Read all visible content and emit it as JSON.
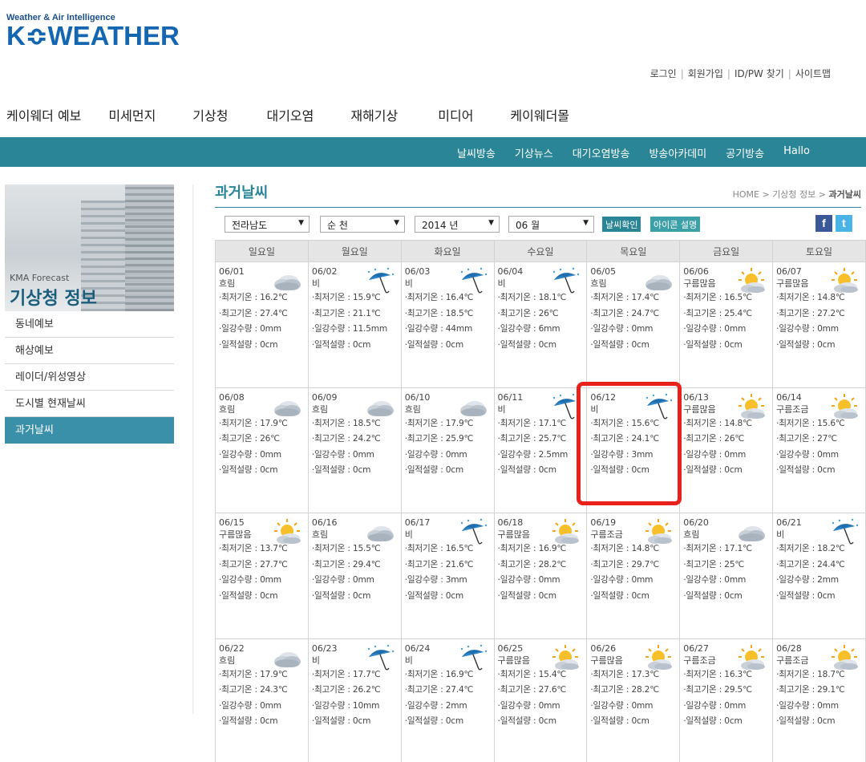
{
  "logo": {
    "tagline": "Weather & Air Intelligence",
    "brand": "K≎WEATHER"
  },
  "util_links": [
    "로그인",
    "회원가입",
    "ID/PW 찾기",
    "사이트맵"
  ],
  "gnb": [
    "케이웨더 예보",
    "미세먼지",
    "기상청",
    "대기오염",
    "재해기상",
    "미디어",
    "케이웨더몰"
  ],
  "subnav": [
    "날씨방송",
    "기상뉴스",
    "대기오염방송",
    "방송아카데미",
    "공기방송",
    "Hallo"
  ],
  "side": {
    "banner_en": "KMA Forecast",
    "banner_ko": "기상청 정보",
    "menu": [
      "동네예보",
      "해상예보",
      "레이더/위성영상",
      "도시별 현재날씨",
      "과거날씨"
    ],
    "active_index": 4
  },
  "main": {
    "title": "과거날씨",
    "breadcrumb": [
      "HOME",
      "기상청 정보",
      "과거날씨"
    ],
    "filters": {
      "region": "전라남도",
      "city": "순 천",
      "year": "2014 년",
      "month": "06 월"
    },
    "btn_check": "날씨확인",
    "btn_icon": "아이콘 설명",
    "sns": [
      "f",
      "t"
    ],
    "weekdays": [
      "일요일",
      "월요일",
      "화요일",
      "수요일",
      "목요일",
      "금요일",
      "토요일"
    ],
    "labels": {
      "min": "·최저기온 : ",
      "max": "·최고기온 : ",
      "rain": "·일강수량 : ",
      "snow": "·일적설량 : "
    },
    "days": [
      {
        "date": "06/01",
        "cond": "흐림",
        "icon": "cloud-icon",
        "min": "16.2℃",
        "max": "27.4℃",
        "rain": "0mm",
        "snow": "0cm"
      },
      {
        "date": "06/02",
        "cond": "비",
        "icon": "umbrella-icon",
        "min": "15.9℃",
        "max": "21.1℃",
        "rain": "11.5mm",
        "snow": "0cm"
      },
      {
        "date": "06/03",
        "cond": "비",
        "icon": "umbrella-icon",
        "min": "16.4℃",
        "max": "18.5℃",
        "rain": "44mm",
        "snow": "0cm"
      },
      {
        "date": "06/04",
        "cond": "비",
        "icon": "umbrella-icon",
        "min": "18.1℃",
        "max": "26℃",
        "rain": "6mm",
        "snow": "0cm"
      },
      {
        "date": "06/05",
        "cond": "흐림",
        "icon": "cloud-icon",
        "min": "17.4℃",
        "max": "24.7℃",
        "rain": "0mm",
        "snow": "0cm"
      },
      {
        "date": "06/06",
        "cond": "구름많음",
        "icon": "sun-cloud-icon",
        "min": "16.5℃",
        "max": "25.4℃",
        "rain": "0mm",
        "snow": "0cm"
      },
      {
        "date": "06/07",
        "cond": "구름많음",
        "icon": "sun-cloud-icon",
        "min": "14.8℃",
        "max": "27.2℃",
        "rain": "0mm",
        "snow": "0cm"
      },
      {
        "date": "06/08",
        "cond": "흐림",
        "icon": "cloud-icon",
        "min": "17.9℃",
        "max": "26℃",
        "rain": "0mm",
        "snow": "0cm"
      },
      {
        "date": "06/09",
        "cond": "흐림",
        "icon": "cloud-icon",
        "min": "18.5℃",
        "max": "24.2℃",
        "rain": "0mm",
        "snow": "0cm"
      },
      {
        "date": "06/10",
        "cond": "흐림",
        "icon": "cloud-icon",
        "min": "17.9℃",
        "max": "25.9℃",
        "rain": "0mm",
        "snow": "0cm"
      },
      {
        "date": "06/11",
        "cond": "비",
        "icon": "umbrella-icon",
        "min": "17.1℃",
        "max": "25.7℃",
        "rain": "2.5mm",
        "snow": "0cm"
      },
      {
        "date": "06/12",
        "cond": "비",
        "icon": "umbrella-icon",
        "min": "15.6℃",
        "max": "24.1℃",
        "rain": "3mm",
        "snow": "0cm"
      },
      {
        "date": "06/13",
        "cond": "구름많음",
        "icon": "sun-cloud-icon",
        "min": "14.8℃",
        "max": "26℃",
        "rain": "0mm",
        "snow": "0cm"
      },
      {
        "date": "06/14",
        "cond": "구름조금",
        "icon": "sun-cloud-icon",
        "min": "15.6℃",
        "max": "27℃",
        "rain": "0mm",
        "snow": "0cm"
      },
      {
        "date": "06/15",
        "cond": "구름많음",
        "icon": "sun-cloud-icon",
        "min": "13.7℃",
        "max": "27.7℃",
        "rain": "0mm",
        "snow": "0cm"
      },
      {
        "date": "06/16",
        "cond": "흐림",
        "icon": "cloud-icon",
        "min": "15.5℃",
        "max": "29.4℃",
        "rain": "0mm",
        "snow": "0cm"
      },
      {
        "date": "06/17",
        "cond": "비",
        "icon": "umbrella-icon",
        "min": "16.5℃",
        "max": "21.6℃",
        "rain": "3mm",
        "snow": "0cm"
      },
      {
        "date": "06/18",
        "cond": "구름많음",
        "icon": "sun-cloud-icon",
        "min": "16.9℃",
        "max": "28.2℃",
        "rain": "0mm",
        "snow": "0cm"
      },
      {
        "date": "06/19",
        "cond": "구름조금",
        "icon": "sun-cloud-icon",
        "min": "14.8℃",
        "max": "29.7℃",
        "rain": "0mm",
        "snow": "0cm"
      },
      {
        "date": "06/20",
        "cond": "흐림",
        "icon": "cloud-icon",
        "min": "17.1℃",
        "max": "25℃",
        "rain": "0mm",
        "snow": "0cm"
      },
      {
        "date": "06/21",
        "cond": "비",
        "icon": "umbrella-icon",
        "min": "18.2℃",
        "max": "24.4℃",
        "rain": "2mm",
        "snow": "0cm"
      },
      {
        "date": "06/22",
        "cond": "흐림",
        "icon": "cloud-icon",
        "min": "17.9℃",
        "max": "24.3℃",
        "rain": "0mm",
        "snow": "0cm"
      },
      {
        "date": "06/23",
        "cond": "비",
        "icon": "umbrella-icon",
        "min": "17.7℃",
        "max": "26.2℃",
        "rain": "10mm",
        "snow": "0cm"
      },
      {
        "date": "06/24",
        "cond": "비",
        "icon": "umbrella-icon",
        "min": "16.9℃",
        "max": "27.4℃",
        "rain": "2mm",
        "snow": "0cm"
      },
      {
        "date": "06/25",
        "cond": "구름많음",
        "icon": "sun-cloud-icon",
        "min": "15.4℃",
        "max": "27.6℃",
        "rain": "0mm",
        "snow": "0cm"
      },
      {
        "date": "06/26",
        "cond": "구름많음",
        "icon": "sun-cloud-icon",
        "min": "17.3℃",
        "max": "28.2℃",
        "rain": "0mm",
        "snow": "0cm"
      },
      {
        "date": "06/27",
        "cond": "구름조금",
        "icon": "sun-cloud-icon",
        "min": "16.3℃",
        "max": "29.5℃",
        "rain": "0mm",
        "snow": "0cm"
      },
      {
        "date": "06/28",
        "cond": "구름조금",
        "icon": "sun-cloud-icon",
        "min": "18.7℃",
        "max": "29.1℃",
        "rain": "0mm",
        "snow": "0cm"
      }
    ]
  },
  "colors": {
    "brand": "#1466b0",
    "accent": "#2a8596",
    "highlight": "#e8211b"
  }
}
